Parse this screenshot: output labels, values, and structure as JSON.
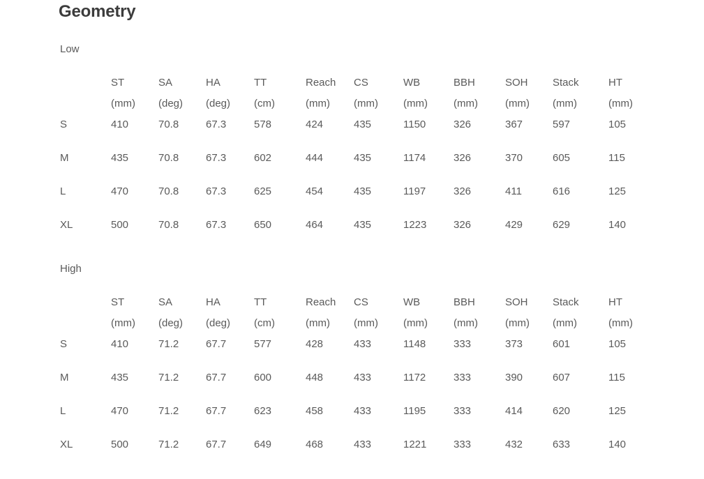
{
  "page": {
    "title": "Geometry"
  },
  "tables": [
    {
      "label": "Low",
      "columns": [
        {
          "abbr": "",
          "unit": ""
        },
        {
          "abbr": "ST",
          "unit": "(mm)"
        },
        {
          "abbr": "SA",
          "unit": "(deg)"
        },
        {
          "abbr": "HA",
          "unit": "(deg)"
        },
        {
          "abbr": "TT",
          "unit": "(cm)"
        },
        {
          "abbr": "Reach",
          "unit": "(mm)"
        },
        {
          "abbr": "CS",
          "unit": "(mm)"
        },
        {
          "abbr": "WB",
          "unit": "(mm)"
        },
        {
          "abbr": "BBH",
          "unit": "(mm)"
        },
        {
          "abbr": "SOH",
          "unit": "(mm)"
        },
        {
          "abbr": "Stack",
          "unit": "(mm)"
        },
        {
          "abbr": "HT",
          "unit": "(mm)"
        }
      ],
      "rows": [
        {
          "size": "S",
          "values": [
            "410",
            "70.8",
            "67.3",
            "578",
            "424",
            "435",
            "1150",
            "326",
            "367",
            "597",
            "105"
          ]
        },
        {
          "size": "M",
          "values": [
            "435",
            "70.8",
            "67.3",
            "602",
            "444",
            "435",
            "1174",
            "326",
            "370",
            "605",
            "115"
          ]
        },
        {
          "size": "L",
          "values": [
            "470",
            "70.8",
            "67.3",
            "625",
            "454",
            "435",
            "1197",
            "326",
            "411",
            "616",
            "125"
          ]
        },
        {
          "size": "XL",
          "values": [
            "500",
            "70.8",
            "67.3",
            "650",
            "464",
            "435",
            "1223",
            "326",
            "429",
            "629",
            "140"
          ]
        }
      ]
    },
    {
      "label": "High",
      "columns": [
        {
          "abbr": "",
          "unit": ""
        },
        {
          "abbr": "ST",
          "unit": "(mm)"
        },
        {
          "abbr": "SA",
          "unit": "(deg)"
        },
        {
          "abbr": "HA",
          "unit": "(deg)"
        },
        {
          "abbr": "TT",
          "unit": "(cm)"
        },
        {
          "abbr": "Reach",
          "unit": "(mm)"
        },
        {
          "abbr": "CS",
          "unit": "(mm)"
        },
        {
          "abbr": "WB",
          "unit": "(mm)"
        },
        {
          "abbr": "BBH",
          "unit": "(mm)"
        },
        {
          "abbr": "SOH",
          "unit": "(mm)"
        },
        {
          "abbr": "Stack",
          "unit": "(mm)"
        },
        {
          "abbr": "HT",
          "unit": "(mm)"
        }
      ],
      "rows": [
        {
          "size": "S",
          "values": [
            "410",
            "71.2",
            "67.7",
            "577",
            "428",
            "433",
            "1148",
            "333",
            "373",
            "601",
            "105"
          ]
        },
        {
          "size": "M",
          "values": [
            "435",
            "71.2",
            "67.7",
            "600",
            "448",
            "433",
            "1172",
            "333",
            "390",
            "607",
            "115"
          ]
        },
        {
          "size": "L",
          "values": [
            "470",
            "71.2",
            "67.7",
            "623",
            "458",
            "433",
            "1195",
            "333",
            "414",
            "620",
            "125"
          ]
        },
        {
          "size": "XL",
          "values": [
            "500",
            "71.2",
            "67.7",
            "649",
            "468",
            "433",
            "1221",
            "333",
            "432",
            "633",
            "140"
          ]
        }
      ]
    }
  ]
}
